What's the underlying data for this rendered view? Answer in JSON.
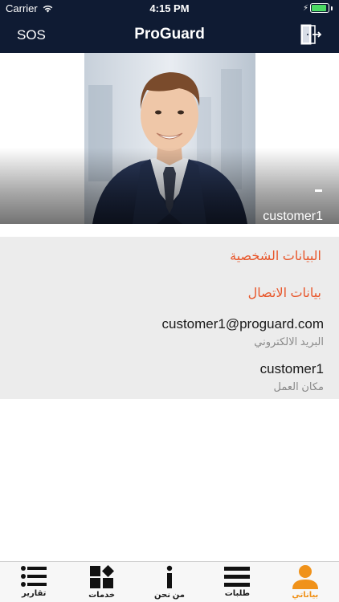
{
  "status_bar": {
    "carrier": "Carrier",
    "time": "4:15 PM",
    "battery_level": 0.9
  },
  "navbar": {
    "left_label": "SOS",
    "title": "ProGuard",
    "right_icon": "logout-door-icon"
  },
  "profile": {
    "photo_icon": "profile-photo",
    "dash": "-",
    "name": "customer1"
  },
  "sections": {
    "personal_data": "البيانات الشخصية",
    "contact_data": "بيانات الاتصال"
  },
  "fields": [
    {
      "value": "customer1@proguard.com",
      "caption": "البريد الالكتروني"
    },
    {
      "value": "customer1",
      "caption": "مكان العمل"
    }
  ],
  "tabs": [
    {
      "label": "تقارير",
      "icon": "list-icon"
    },
    {
      "label": "خدمات",
      "icon": "services-grid-icon"
    },
    {
      "label": "من نحن",
      "icon": "info-icon"
    },
    {
      "label": "طلبات",
      "icon": "menu-bars-icon"
    },
    {
      "label": "بياناتي",
      "icon": "person-icon"
    }
  ],
  "colors": {
    "header": "#0f1b33",
    "accent": "#e8562a",
    "active_tab": "#f0921a",
    "info_bg": "#ececec"
  }
}
